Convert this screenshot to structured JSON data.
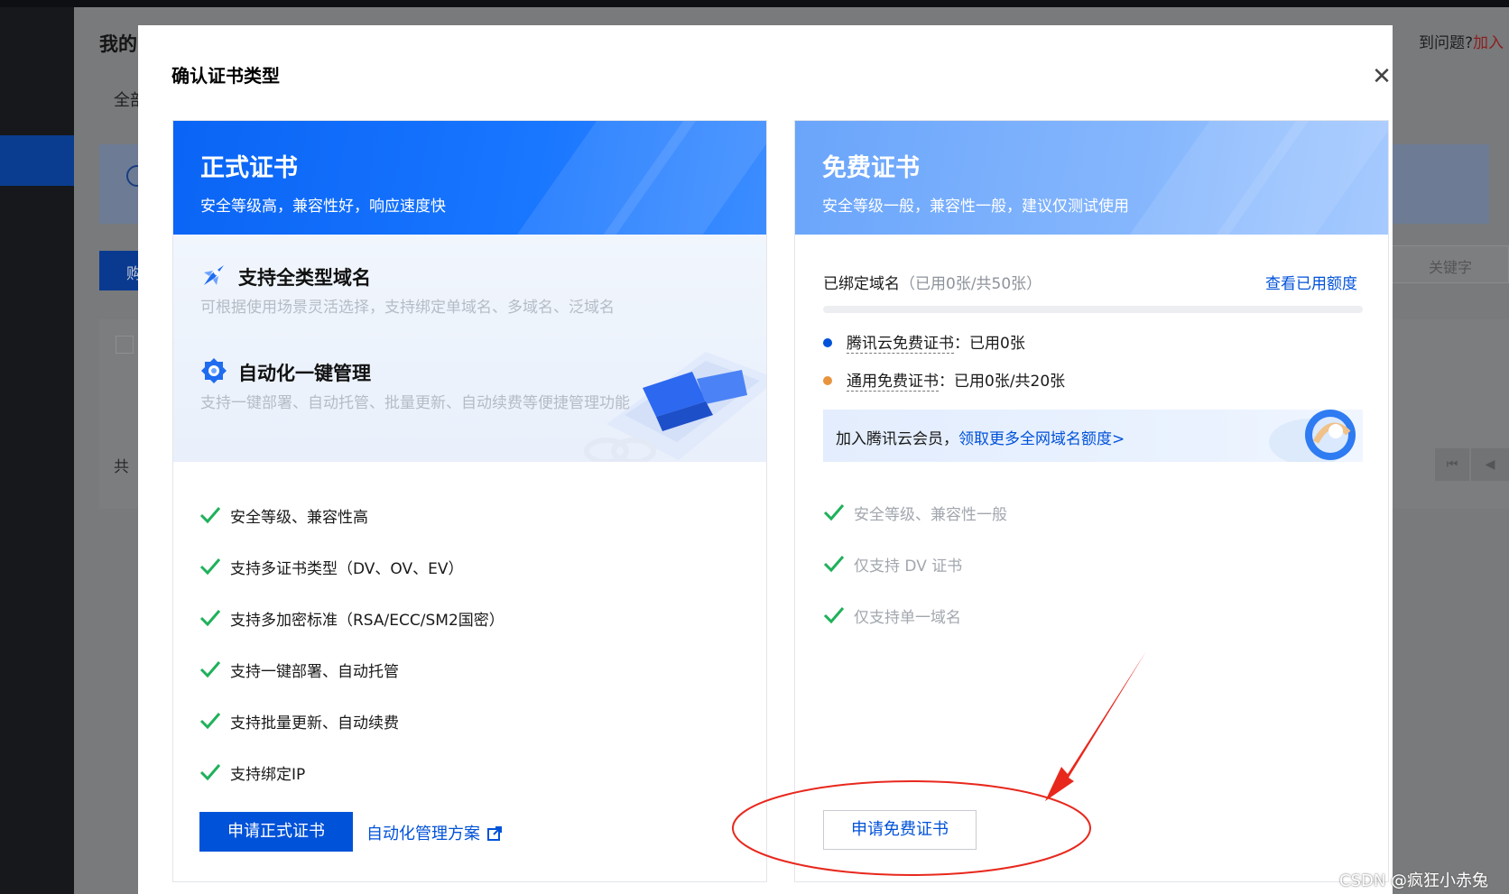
{
  "background": {
    "page_title": "我的",
    "tab_label": "全部",
    "button_label": "购",
    "search_placeholder": "关键字",
    "total_label": "共",
    "help_text": "到问题?",
    "help_link": "加入"
  },
  "dialog": {
    "title": "确认证书类型",
    "close_symbol": "✕"
  },
  "paid_card": {
    "title": "正式证书",
    "subtitle": "安全等级高，兼容性好，响应速度快",
    "features": [
      {
        "icon": "rocket-icon",
        "title": "支持全类型域名",
        "desc": "可根据使用场景灵活选择，支持绑定单域名、多域名、泛域名"
      },
      {
        "icon": "badge-gear-icon",
        "title": "自动化一键管理",
        "desc": "支持一键部署、自动托管、批量更新、自动续费等便捷管理功能"
      }
    ],
    "checklist": [
      "安全等级、兼容性高",
      "支持多证书类型（DV、OV、EV）",
      "支持多加密标准（RSA/ECC/SM2国密）",
      "支持一键部署、自动托管",
      "支持批量更新、自动续费",
      "支持绑定IP"
    ],
    "apply_button": "申请正式证书",
    "automation_link": "自动化管理方案"
  },
  "free_card": {
    "title": "免费证书",
    "subtitle": "安全等级一般，兼容性一般，建议仅测试使用",
    "bound_label": "已绑定域名",
    "bound_usage": "（已用0张/共50张）",
    "view_quota_link": "查看已用额度",
    "usage_ratio": 0,
    "quotas": [
      {
        "name": "腾讯云免费证书",
        "sep": "：",
        "value": "已用0张",
        "color": "#0052d9"
      },
      {
        "name": "通用免费证书",
        "sep": "：",
        "value": "已用0张/共20张",
        "color": "#e8943f"
      }
    ],
    "member_text": "加入腾讯云会员，",
    "member_link": "领取更多全网域名额度>",
    "checklist": [
      "安全等级、兼容性一般",
      "仅支持 DV 证书",
      "仅支持单一域名"
    ],
    "apply_button": "申请免费证书"
  },
  "watermark": "CSDN @疯狂小赤兔",
  "colors": {
    "primary": "#0052d9",
    "check_green": "#1fb15b",
    "annotation_red": "#e8281d"
  }
}
